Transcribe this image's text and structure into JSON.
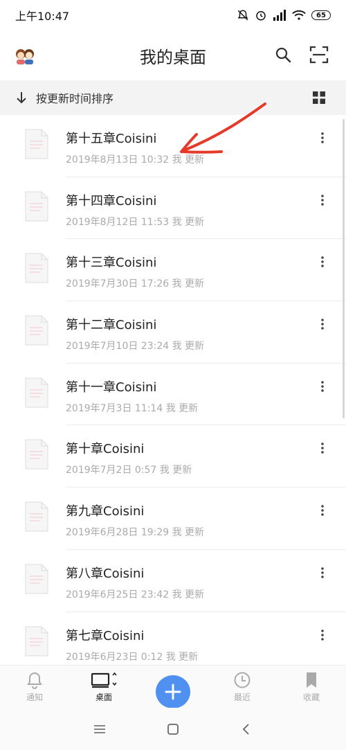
{
  "status_bar": {
    "time": "上午10:47",
    "battery": "65"
  },
  "header": {
    "title": "我的桌面",
    "avatar_icon": "avatar-icon",
    "search_icon": "search-icon",
    "scan_icon": "scan-icon"
  },
  "sort_bar": {
    "label": "按更新时间排序",
    "arrow_icon": "arrow-down-icon",
    "view_icon": "grid-view-icon"
  },
  "files": [
    {
      "name": "第十五章Coisini",
      "meta": "2019年8月13日 10:32 我 更新"
    },
    {
      "name": "第十四章Coisini",
      "meta": "2019年8月12日 11:53 我 更新"
    },
    {
      "name": "第十三章Coisini",
      "meta": "2019年7月30日 17:26 我 更新"
    },
    {
      "name": "第十二章Coisini",
      "meta": "2019年7月10日 23:24 我 更新"
    },
    {
      "name": "第十一章Coisini",
      "meta": "2019年7月3日 11:14 我 更新"
    },
    {
      "name": "第十章Coisini",
      "meta": "2019年7月2日 0:57 我 更新"
    },
    {
      "name": "第九章Coisini",
      "meta": "2019年6月28日 19:29 我 更新"
    },
    {
      "name": "第八章Coisini",
      "meta": "2019年6月25日 23:42 我 更新"
    },
    {
      "name": "第七章Coisini",
      "meta": "2019年6月23日 0:12 我 更新"
    }
  ],
  "bottom_nav": {
    "notify": "通知",
    "desktop": "桌面",
    "recent": "最近",
    "favorites": "收藏"
  },
  "colors": {
    "accent": "#4f90f0",
    "annotation": "#e53a2a"
  }
}
